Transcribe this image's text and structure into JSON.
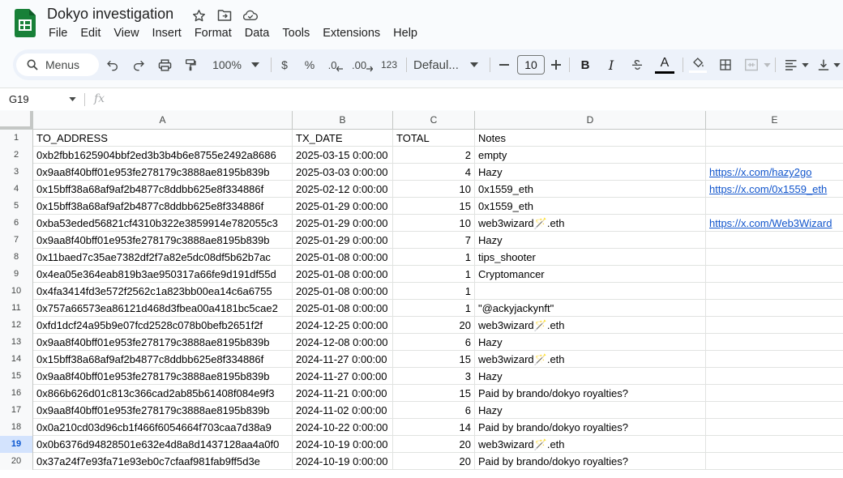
{
  "document": {
    "title": "Dokyo investigation"
  },
  "menu": [
    "File",
    "Edit",
    "View",
    "Insert",
    "Format",
    "Data",
    "Tools",
    "Extensions",
    "Help"
  ],
  "toolbar": {
    "search_label": "Menus",
    "zoom": "100%",
    "currency": "$",
    "percent": "%",
    "decrease_decimal": ".0",
    "increase_decimal": ".00",
    "number_format": "123",
    "font": "Defaul...",
    "font_size": "10",
    "bold": "B",
    "italic": "I",
    "text_color_letter": "A"
  },
  "formula_bar": {
    "cell_ref": "G19",
    "fx": "fx"
  },
  "colors": {
    "sheets_green": "#188038",
    "selected_row_bg": "#d3e3fd",
    "link": "#1155cc"
  },
  "grid": {
    "columns": [
      "A",
      "B",
      "C",
      "D",
      "E"
    ],
    "selected_row": "19",
    "rows": [
      {
        "n": "1",
        "a": "TO_ADDRESS",
        "b": "TX_DATE",
        "c": "TOTAL",
        "d": "Notes",
        "e": ""
      },
      {
        "n": "2",
        "a": "0xb2fbb1625904bbf2ed3b3b4b6e8755e2492a8686",
        "b": "2025-03-15 0:00:00",
        "c": "2",
        "d": "empty",
        "e": ""
      },
      {
        "n": "3",
        "a": "0x9aa8f40bff01e953fe278179c3888ae8195b839b",
        "b": "2025-03-03 0:00:00",
        "c": "4",
        "d": "Hazy",
        "e": "https://x.com/hazy2go"
      },
      {
        "n": "4",
        "a": "0x15bff38a68af9af2b4877c8ddbb625e8f334886f",
        "b": "2025-02-12 0:00:00",
        "c": "10",
        "d": "0x1559_eth",
        "e": "https://x.com/0x1559_eth"
      },
      {
        "n": "5",
        "a": "0x15bff38a68af9af2b4877c8ddbb625e8f334886f",
        "b": "2025-01-29 0:00:00",
        "c": "15",
        "d": "0x1559_eth",
        "e": ""
      },
      {
        "n": "6",
        "a": "0xba53eded56821cf4310b322e3859914e782055c3",
        "b": "2025-01-29 0:00:00",
        "c": "10",
        "d": "web3wizard🪄.eth",
        "e": "https://x.com/Web3Wizard"
      },
      {
        "n": "7",
        "a": "0x9aa8f40bff01e953fe278179c3888ae8195b839b",
        "b": "2025-01-29 0:00:00",
        "c": "7",
        "d": "Hazy",
        "e": ""
      },
      {
        "n": "8",
        "a": "0x11baed7c35ae7382df2f7a82e5dc08df5b62b7ac",
        "b": "2025-01-08 0:00:00",
        "c": "1",
        "d": "tips_shooter",
        "e": ""
      },
      {
        "n": "9",
        "a": "0x4ea05e364eab819b3ae950317a66fe9d191df55d",
        "b": "2025-01-08 0:00:00",
        "c": "1",
        "d": "Cryptomancer",
        "e": ""
      },
      {
        "n": "10",
        "a": "0x4fa3414fd3e572f2562c1a823bb00ea14c6a6755",
        "b": "2025-01-08 0:00:00",
        "c": "1",
        "d": "",
        "e": ""
      },
      {
        "n": "11",
        "a": "0x757a66573ea86121d468d3fbea00a4181bc5cae2",
        "b": "2025-01-08 0:00:00",
        "c": "1",
        "d": "\"@ackyjackynft\"",
        "e": ""
      },
      {
        "n": "12",
        "a": "0xfd1dcf24a95b9e07fcd2528c078b0befb2651f2f",
        "b": "2024-12-25 0:00:00",
        "c": "20",
        "d": "web3wizard🪄.eth",
        "e": ""
      },
      {
        "n": "13",
        "a": "0x9aa8f40bff01e953fe278179c3888ae8195b839b",
        "b": "2024-12-08 0:00:00",
        "c": "6",
        "d": "Hazy",
        "e": ""
      },
      {
        "n": "14",
        "a": "0x15bff38a68af9af2b4877c8ddbb625e8f334886f",
        "b": "2024-11-27 0:00:00",
        "c": "15",
        "d": "web3wizard🪄.eth",
        "e": ""
      },
      {
        "n": "15",
        "a": "0x9aa8f40bff01e953fe278179c3888ae8195b839b",
        "b": "2024-11-27 0:00:00",
        "c": "3",
        "d": "Hazy",
        "e": ""
      },
      {
        "n": "16",
        "a": "0x866b626d01c813c366cad2ab85b61408f084e9f3",
        "b": "2024-11-21 0:00:00",
        "c": "15",
        "d": "Paid by brando/dokyo royalties?",
        "e": ""
      },
      {
        "n": "17",
        "a": "0x9aa8f40bff01e953fe278179c3888ae8195b839b",
        "b": "2024-11-02 0:00:00",
        "c": "6",
        "d": "Hazy",
        "e": ""
      },
      {
        "n": "18",
        "a": "0x0a210cd03d96cb1f466f6054664f703caa7d38a9",
        "b": "2024-10-22 0:00:00",
        "c": "14",
        "d": "Paid by brando/dokyo royalties?",
        "e": ""
      },
      {
        "n": "19",
        "a": "0x0b6376d94828501e632e4d8a8d1437128aa4a0f0",
        "b": "2024-10-19 0:00:00",
        "c": "20",
        "d": "web3wizard🪄.eth",
        "e": ""
      },
      {
        "n": "20",
        "a": "0x37a24f7e93fa71e93eb0c7cfaaf981fab9ff5d3e",
        "b": "2024-10-19 0:00:00",
        "c": "20",
        "d": "Paid by brando/dokyo royalties?",
        "e": ""
      }
    ]
  }
}
